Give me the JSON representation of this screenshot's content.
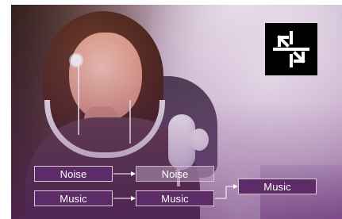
{
  "diagram": {
    "top_left_label": "Noise",
    "top_right_label": "Noise",
    "bottom_left_label": "Music",
    "bottom_middle_label": "Music",
    "bottom_right_label": "Music"
  },
  "colors": {
    "accent": "#5d2c68",
    "logo_bg": "#000000",
    "text": "#ffffff"
  },
  "icons": {
    "logo": "compress-arrows-icon"
  }
}
